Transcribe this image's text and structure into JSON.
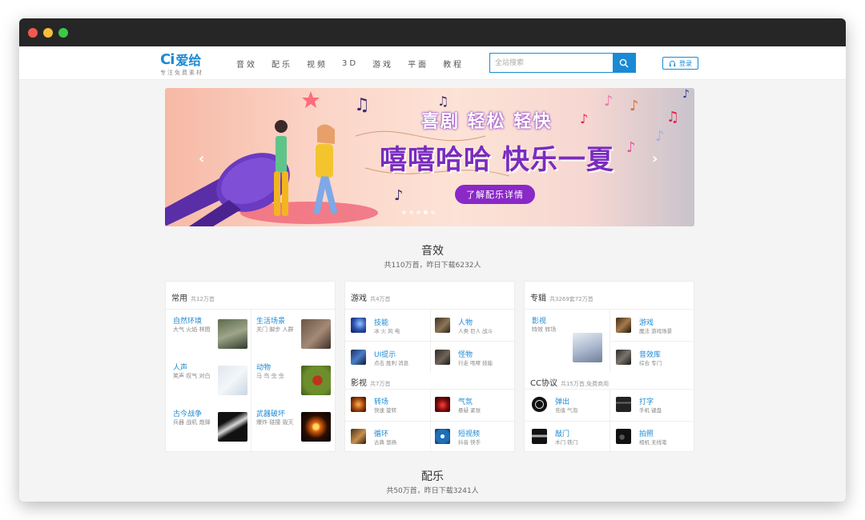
{
  "window": {
    "controls": [
      "close",
      "minimize",
      "maximize"
    ]
  },
  "header": {
    "logo_mark": "Ci",
    "logo_text": "爱给",
    "logo_slogan": "专注免费素材",
    "nav": [
      "音效",
      "配乐",
      "视频",
      "3D",
      "游戏",
      "平面",
      "教程"
    ],
    "search_placeholder": "全站搜索",
    "login_label": "登录"
  },
  "banner": {
    "title1": "喜剧 轻松 轻快",
    "title2": "嘻嘻哈哈 快乐一夏",
    "cta": "了解配乐详情",
    "dots_total": 5,
    "dots_active": 3
  },
  "sections": {
    "sfx": {
      "title": "音效",
      "sub": "共110万首，昨日下载6232人"
    },
    "music": {
      "title": "配乐",
      "sub": "共50万首，昨日下载3241人"
    }
  },
  "cards": {
    "common": {
      "title": "常用",
      "count": "共12万首",
      "items": [
        {
          "title": "自然环境",
          "sub": "大气 火焰 林間"
        },
        {
          "title": "生活场景",
          "sub": "关门 脚步 人群"
        },
        {
          "title": "人声",
          "sub": "笑声 叹气 对白"
        },
        {
          "title": "动物",
          "sub": "马 鸟 虫 虫"
        },
        {
          "title": "古今战争",
          "sub": "兵器 战机 炮弹"
        },
        {
          "title": "武器破坏",
          "sub": "爆炸 碰撞 毁灭"
        }
      ]
    },
    "games": {
      "title": "游戏",
      "count": "共4万首",
      "items": [
        {
          "title": "技能",
          "sub": "冰 火 风 电"
        },
        {
          "title": "人物",
          "sub": "人类 巨人 战斗"
        },
        {
          "title": "UI提示",
          "sub": "点击 胜利 消息"
        },
        {
          "title": "怪物",
          "sub": "行走 咆哮 技能"
        }
      ],
      "sub_section": {
        "title": "影视",
        "count": "共7万首"
      },
      "sub_items": [
        {
          "title": "转场",
          "sub": "快速 旋转"
        },
        {
          "title": "气氛",
          "sub": "悬疑 紧张"
        },
        {
          "title": "循环",
          "sub": "古典 悠扬"
        },
        {
          "title": "短视频",
          "sub": "抖音 快手"
        }
      ]
    },
    "albums": {
      "title": "专辑",
      "count": "共3269套72万首",
      "items": [
        {
          "title": "影视",
          "sub": "特效 转场"
        },
        {
          "title": "游戏",
          "sub": "魔法 游戏场景"
        },
        {
          "title": "音效库",
          "sub": "综合 专门"
        }
      ],
      "sub_section": {
        "title": "CC协议",
        "count": "共15万首,免费商用"
      },
      "sub_items": [
        {
          "title": "弹出",
          "sub": "充值 气泡"
        },
        {
          "title": "打字",
          "sub": "手机 键盘"
        },
        {
          "title": "敲门",
          "sub": "木门 铁门"
        },
        {
          "title": "拍照",
          "sub": "相机 无线笔"
        }
      ]
    }
  },
  "colors": {
    "brand": "#1a8ad4",
    "banner_purple": "#8a28c8",
    "titlebar": "#262626"
  }
}
